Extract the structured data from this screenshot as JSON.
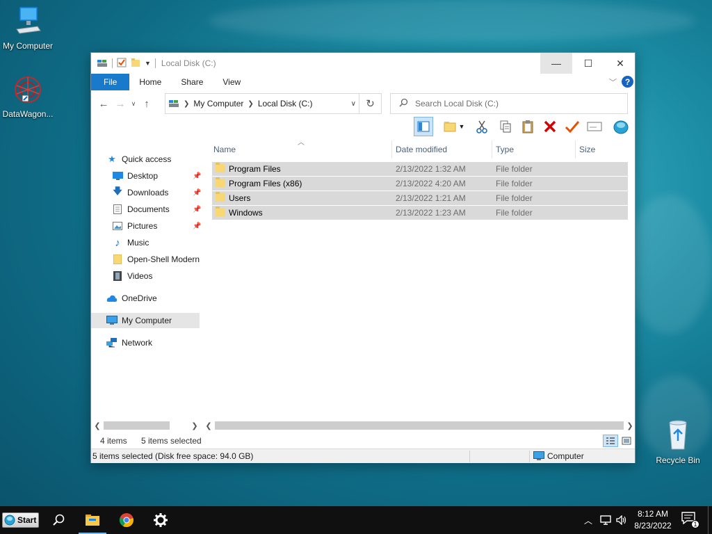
{
  "desktop": {
    "icons": [
      {
        "label": "My Computer",
        "icon": "computer-icon"
      },
      {
        "label": "DataWagon...",
        "icon": "datawagon-icon"
      },
      {
        "label": "Recycle Bin",
        "icon": "recycle-bin-icon"
      }
    ]
  },
  "window": {
    "title": "Local Disk (C:)",
    "controls": {
      "minimize": "—",
      "maximize": "☐",
      "close": "✕"
    },
    "ribbon_tabs": [
      "File",
      "Home",
      "Share",
      "View"
    ],
    "help": "?",
    "address": {
      "crumbs": [
        "My Computer",
        "Local Disk (C:)"
      ]
    },
    "search": {
      "placeholder": "Search Local Disk (C:)"
    },
    "nav": {
      "quick_access": "Quick access",
      "items": [
        {
          "label": "Desktop",
          "icon": "desktop-icon",
          "pinned": true
        },
        {
          "label": "Downloads",
          "icon": "downloads-icon",
          "pinned": true
        },
        {
          "label": "Documents",
          "icon": "documents-icon",
          "pinned": true
        },
        {
          "label": "Pictures",
          "icon": "pictures-icon",
          "pinned": true
        },
        {
          "label": "Music",
          "icon": "music-icon",
          "pinned": false
        },
        {
          "label": "Open-Shell Modern",
          "icon": "folder-icon",
          "pinned": false
        },
        {
          "label": "Videos",
          "icon": "videos-icon",
          "pinned": false
        }
      ],
      "onedrive": "OneDrive",
      "my_computer": "My Computer",
      "network": "Network"
    },
    "columns": [
      "Name",
      "Date modified",
      "Type",
      "Size"
    ],
    "rows": [
      {
        "name": "Program Files",
        "date": "2/13/2022 1:32 AM",
        "type": "File folder",
        "size": ""
      },
      {
        "name": "Program Files (x86)",
        "date": "2/13/2022 4:20 AM",
        "type": "File folder",
        "size": ""
      },
      {
        "name": "Users",
        "date": "2/13/2022 1:21 AM",
        "type": "File folder",
        "size": ""
      },
      {
        "name": "Windows",
        "date": "2/13/2022 1:23 AM",
        "type": "File folder",
        "size": ""
      }
    ],
    "status": {
      "item_count": "4 items",
      "selected": "5 items selected",
      "bar_text": "5 items selected (Disk free space: 94.0 GB)",
      "location": "Computer"
    }
  },
  "taskbar": {
    "start_label": "Start",
    "time": "8:12 AM",
    "date": "8/23/2022",
    "notifications": "1",
    "accent": "#76b9ed"
  }
}
